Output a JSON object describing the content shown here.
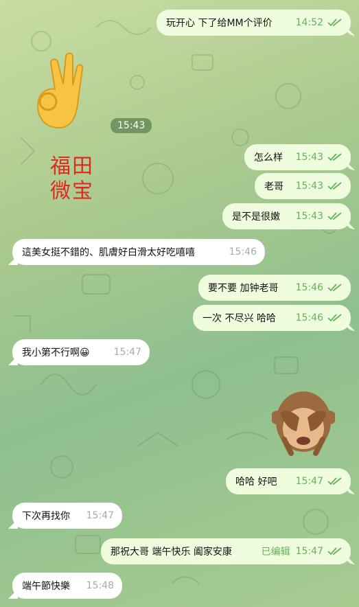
{
  "sticker": {
    "time": "15:43",
    "caption_line1": "福田",
    "caption_line2": "微宝",
    "icon": "ok-hand-emoji"
  },
  "monkey": {
    "icon": "see-no-evil-monkey-emoji"
  },
  "messages": [
    {
      "dir": "out",
      "text": "玩开心 下了给MM个评价",
      "time": "14:52",
      "read": true
    },
    {
      "dir": "out",
      "text": "怎么样",
      "time": "15:43",
      "read": true
    },
    {
      "dir": "out",
      "text": "老哥",
      "time": "15:43",
      "read": true
    },
    {
      "dir": "out",
      "text": "是不是很嫩",
      "time": "15:43",
      "read": true
    },
    {
      "dir": "in",
      "text": "這美女挺不錯的、肌膚好白滑太好吃嘻嘻",
      "time": "15:46"
    },
    {
      "dir": "out",
      "text": "要不要 加钟老哥",
      "time": "15:46",
      "read": true
    },
    {
      "dir": "out",
      "text": "一次 不尽兴  哈哈",
      "time": "15:46",
      "read": true
    },
    {
      "dir": "in",
      "text": "我小第不行啊😀",
      "time": "15:47"
    },
    {
      "dir": "out",
      "text": "哈哈   好吧",
      "time": "15:47",
      "read": true
    },
    {
      "dir": "in",
      "text": "下次再找你",
      "time": "15:47"
    },
    {
      "dir": "out",
      "text": "那祝大哥 端午快乐  阖家安康",
      "time": "15:47",
      "edited": "已编辑",
      "read": true
    },
    {
      "dir": "in",
      "text": "端午節快樂",
      "time": "15:48"
    }
  ]
}
